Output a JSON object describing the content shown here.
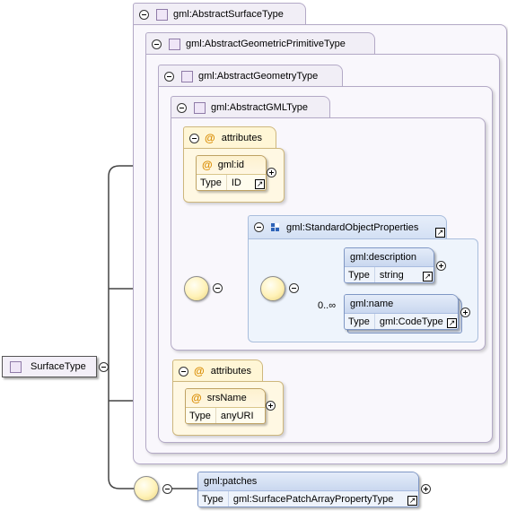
{
  "types": {
    "abstract_surface": "gml:AbstractSurfaceType",
    "abstract_geometric_primitive": "gml:AbstractGeometricPrimitiveType",
    "abstract_geometry": "gml:AbstractGeometryType",
    "abstract_gml": "gml:AbstractGMLType"
  },
  "root": {
    "label": "SurfaceType"
  },
  "attributes_group_1": {
    "title": "attributes",
    "attr": {
      "name": "gml:id",
      "type_key": "Type",
      "type_value": "ID"
    }
  },
  "standard_props": {
    "title": "gml:StandardObjectProperties",
    "description": {
      "name": "gml:description",
      "type_key": "Type",
      "type_value": "string"
    },
    "name_elem": {
      "name": "gml:name",
      "type_key": "Type",
      "type_value": "gml:CodeType",
      "cardinality": "0..∞"
    }
  },
  "attributes_group_2": {
    "title": "attributes",
    "attr": {
      "name": "srsName",
      "type_key": "Type",
      "type_value": "anyURI"
    }
  },
  "patches": {
    "name": "gml:patches",
    "type_key": "Type",
    "type_value": "gml:SurfacePatchArrayPropertyType"
  },
  "icons": {
    "collapse": "minus-circle-icon",
    "expand": "plus-circle-icon",
    "sequence": "sequence-compositor-icon",
    "complex_type": "complex-type-square-icon",
    "attribute": "at-sign-icon",
    "group": "group-icon",
    "external_link": "external-link-icon"
  },
  "colors": {
    "type_container": "#f9f7fc",
    "attribute_fill": "#fff8e3",
    "element_header": "#c9d7ef",
    "compositor": "#fff2b8"
  }
}
